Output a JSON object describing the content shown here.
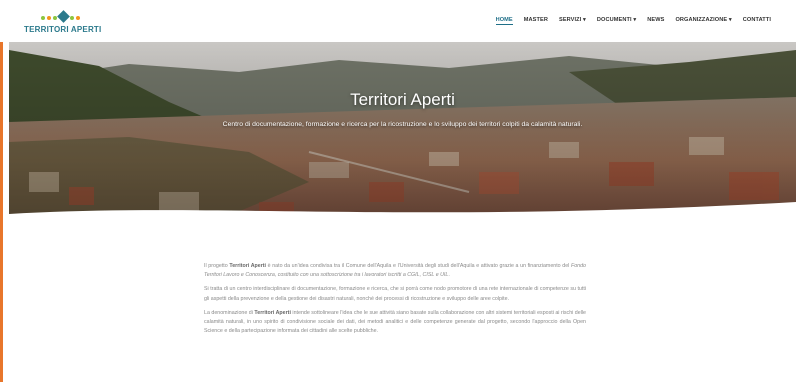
{
  "brand": {
    "logo_text": "TERRITORI APERTI"
  },
  "colors": {
    "accent": "#1f6f88",
    "logo_green": "#8cc63f",
    "logo_orange": "#f7941d",
    "logo_teal": "#2c7a8c",
    "left_bar": "#e8762b"
  },
  "nav": {
    "items": [
      {
        "label": "HOME",
        "active": true,
        "dropdown": false
      },
      {
        "label": "MASTER",
        "active": false,
        "dropdown": false
      },
      {
        "label": "SERVIZI ▾",
        "active": false,
        "dropdown": true
      },
      {
        "label": "DOCUMENTI ▾",
        "active": false,
        "dropdown": true
      },
      {
        "label": "NEWS",
        "active": false,
        "dropdown": false
      },
      {
        "label": "ORGANIZZAZIONE ▾",
        "active": false,
        "dropdown": true
      },
      {
        "label": "CONTATTI",
        "active": false,
        "dropdown": false
      }
    ]
  },
  "hero": {
    "title": "Territori Aperti",
    "subtitle": "Centro di documentazione, formazione e ricerca per la ricostruzione e lo sviluppo dei territori colpiti da calamità naturali."
  },
  "body": {
    "p1": {
      "t1": "Il progetto ",
      "b1": "Territori Aperti",
      "t2": " è nato da un'idea condivisa tra il Comune dell'Aquila e l'Università degli studi dell'Aquila e attivato grazie a un finanziamento del ",
      "i1": "Fondo Territori Lavoro e Conoscenza, costituito con una sottoscrizione tra i lavoratori iscritti a CGIL, CISL e UIL",
      "t3": "."
    },
    "p2": "Si tratta di un centro interdisciplinare di documentazione, formazione e ricerca, che si porrà come nodo promotore di una rete internazionale di competenze su tutti gli aspetti della prevenzione e della gestione dei disastri naturali, nonché dei processi di ricostruzione e sviluppo delle aree colpite.",
    "p3": {
      "t1": "La denominazione di ",
      "b1": "Territori Aperti",
      "t2": " intende sottolineare l'idea che le sue attività siano basate sulla collaborazione con altri sistemi territoriali esposti ai rischi delle calamità naturali, in uno spirito di condivisione sociale dei dati, dei metodi analitici e delle competenze generate dal progetto, secondo l'approccio della Open Science e della partecipazione informata dei cittadini alle scelte pubbliche."
    }
  }
}
